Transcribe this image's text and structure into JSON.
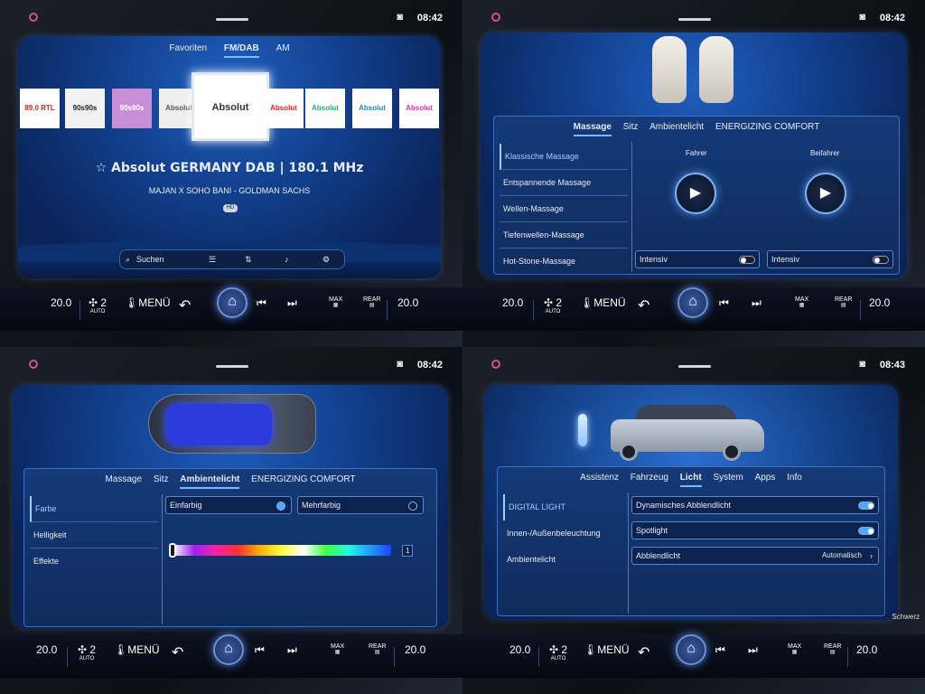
{
  "status": {
    "q1": {
      "time": "08:42"
    },
    "q2": {
      "time": "08:42"
    },
    "q3": {
      "time": "08:42"
    },
    "q4": {
      "time": "08:43"
    }
  },
  "climate": {
    "temp_left": "20.0",
    "temp_right": "20.0",
    "fan_level": "2",
    "fan_mode": "AUTO",
    "menu_label": "MENÜ",
    "max_label": "MAX",
    "rear_label": "REAR"
  },
  "map_label": "Schwerz",
  "radio": {
    "tabs": [
      "Favoriten",
      "FM/DAB",
      "AM"
    ],
    "active_tab": "FM/DAB",
    "tiles": [
      "89.0 RTL",
      "90s90s",
      "90s90s",
      "Absolut Bella",
      "Absolut Germany",
      "Absolut HOT",
      "Absolut Oldie",
      "Absolut relax",
      "Absolut TOP"
    ],
    "station": "☆ Absolut GERMANY DAB | 180.1 MHz",
    "song": "MAJAN X SOHO BANI - GOLDMAN SACHS",
    "hd": "HD",
    "search_label": "Suchen"
  },
  "seats": {
    "tabs": [
      "Massage",
      "Sitz",
      "Ambientelicht",
      "ENERGIZING COMFORT"
    ],
    "active_tab": "Massage",
    "programs": [
      "Klassische Massage",
      "Entspannende Massage",
      "Wellen-Massage",
      "Tiefenwellen-Massage",
      "Hot-Stone-Massage"
    ],
    "selected": "Klassische Massage",
    "driver_label": "Fahrer",
    "passenger_label": "Beifahrer",
    "intensity_driver": "Intensiv",
    "intensity_passenger": "Intensiv"
  },
  "ambient": {
    "tabs": [
      "Massage",
      "Sitz",
      "Ambientelicht",
      "ENERGIZING COMFORT"
    ],
    "active_tab": "Ambientelicht",
    "menu": [
      "Farbe",
      "Helligkeit",
      "Effekte"
    ],
    "selected": "Farbe",
    "option_single": "Einfarbig",
    "option_multi": "Mehrfarbig",
    "color_value": "1"
  },
  "light": {
    "tabs": [
      "Assistenz",
      "Fahrzeug",
      "Licht",
      "System",
      "Apps",
      "Info"
    ],
    "active_tab": "Licht",
    "menu": [
      "DIGITAL LIGHT",
      "Innen-/Außenbeleuchtung",
      "Ambientelicht"
    ],
    "selected": "DIGITAL LIGHT",
    "dyn_label": "Dynamisches Abblendlicht",
    "spot_label": "Spotlight",
    "low_label": "Abblendlicht",
    "low_value": "Automatisch",
    "dyn_on": true,
    "spot_on": true
  },
  "colors": {
    "accent": "#7ab8ff",
    "panel": "#153a78",
    "screen": "#123f8c"
  }
}
